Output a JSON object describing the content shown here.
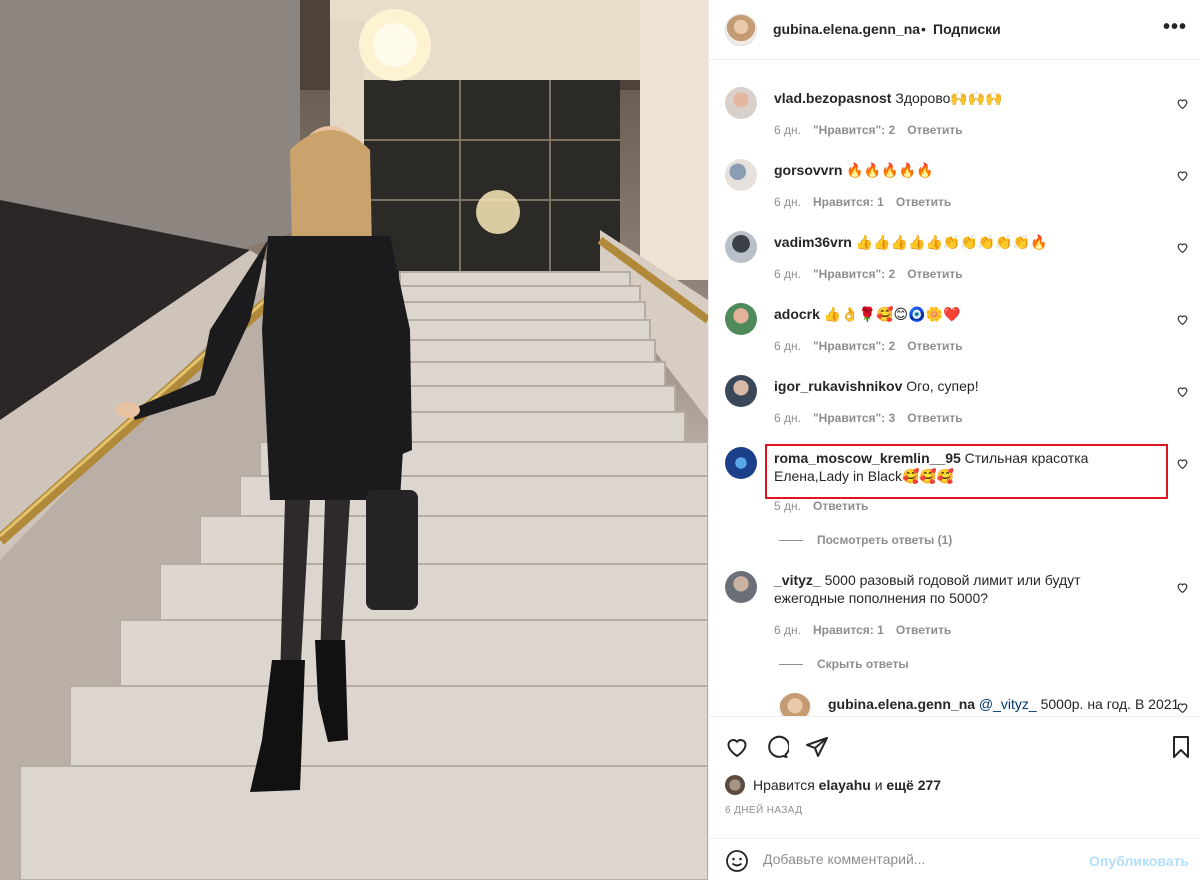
{
  "post": {
    "author": "gubina.elena.genn_na",
    "separator": "•",
    "follow_label": "Подписки",
    "more_label": "•••"
  },
  "comments": [
    {
      "user": "vlad.bezopasnost",
      "text": "Здорово🙌🙌🙌",
      "time": "6 дн.",
      "likes": "\"Нравится\": 2",
      "reply": "Ответить"
    },
    {
      "user": "gorsovvrn",
      "text": "🔥🔥🔥🔥🔥",
      "time": "6 дн.",
      "likes": "Нравится: 1",
      "reply": "Ответить"
    },
    {
      "user": "vadim36vrn",
      "text": "👍👍👍👍👍👏👏👏👏👏🔥",
      "time": "6 дн.",
      "likes": "\"Нравится\": 2",
      "reply": "Ответить"
    },
    {
      "user": "adocrk",
      "text": "👍👌🌹🥰😊🧿🌼❤️",
      "time": "6 дн.",
      "likes": "\"Нравится\": 2",
      "reply": "Ответить"
    },
    {
      "user": "igor_rukavishnikov",
      "text": "Ого, супер!",
      "time": "6 дн.",
      "likes": "\"Нравится\": 3",
      "reply": "Ответить"
    },
    {
      "user": "roma_moscow_kremlin__95",
      "text": "Стильная красотка Елена,Lady in Black🥰🥰🥰",
      "time": "5 дн.",
      "likes": "",
      "reply": "Ответить"
    },
    {
      "user": "_vityz_",
      "text": "5000 разовый годовой лимит или будут ежегодные пополнения по 5000?",
      "time": "6 дн.",
      "likes": "Нравится: 1",
      "reply": "Ответить"
    }
  ],
  "view_replies": "Посмотреть ответы (1)",
  "hide_replies": "Скрыть ответы",
  "reply_comment": {
    "user": "gubina.elena.genn_na",
    "mention": "@_vityz_",
    "text": "5000р. на год. В 2021"
  },
  "likes": {
    "prefix": "Нравится",
    "user": "elayahu",
    "conj": "и",
    "rest": "ещё 277"
  },
  "date": "6 ДНЕЙ НАЗАД",
  "add_comment": {
    "placeholder": "Добавьте комментарий...",
    "publish": "Опубликовать"
  },
  "icons": [
    "heart-icon",
    "comment-icon",
    "share-icon",
    "bookmark-icon",
    "smile-icon",
    "more-icon"
  ]
}
